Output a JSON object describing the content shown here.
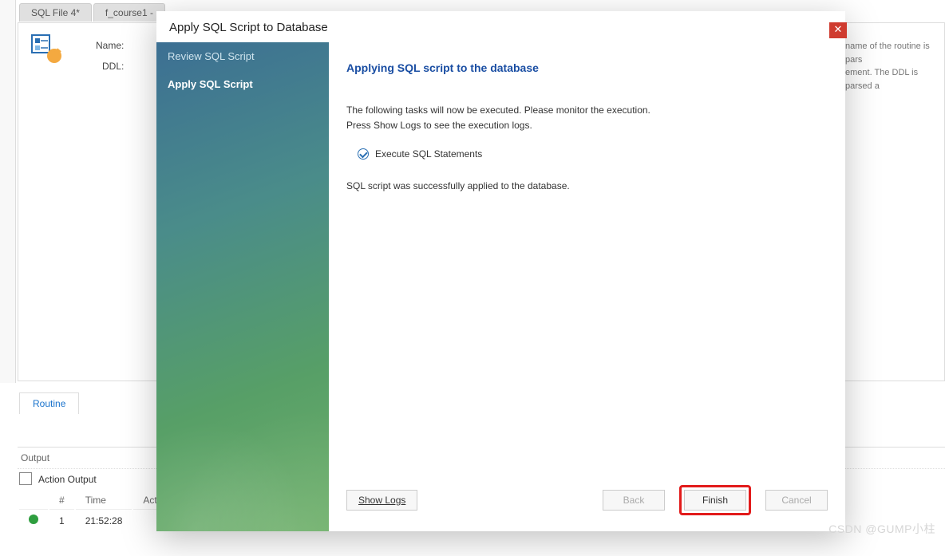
{
  "tabs": {
    "file": "SQL File 4*",
    "course": "f_course1 -"
  },
  "editor": {
    "name_label": "Name:",
    "ddl_label": "DDL:"
  },
  "hint": {
    "line1": "name of the routine is pars",
    "line2": "ement. The DDL is parsed a"
  },
  "routine_tab": "Routine",
  "output": {
    "header": "Output",
    "type": "Action Output",
    "cols": {
      "idx": "#",
      "time": "Time",
      "action": "Action"
    },
    "row": {
      "idx": "1",
      "time": "21:52:28",
      "action": ""
    }
  },
  "dialog": {
    "title": "Apply SQL Script to Database",
    "steps": {
      "review": "Review SQL Script",
      "apply": "Apply SQL Script"
    },
    "heading": "Applying SQL script to the database",
    "body1": "The following tasks will now be executed. Please monitor the execution.",
    "body2": "Press Show Logs to see the execution logs.",
    "task": "Execute SQL Statements",
    "result": "SQL script was successfully applied to the database.",
    "buttons": {
      "showlogs": "Show Logs",
      "back": "Back",
      "finish": "Finish",
      "cancel": "Cancel"
    }
  },
  "watermark": "CSDN @GUMP小柱"
}
